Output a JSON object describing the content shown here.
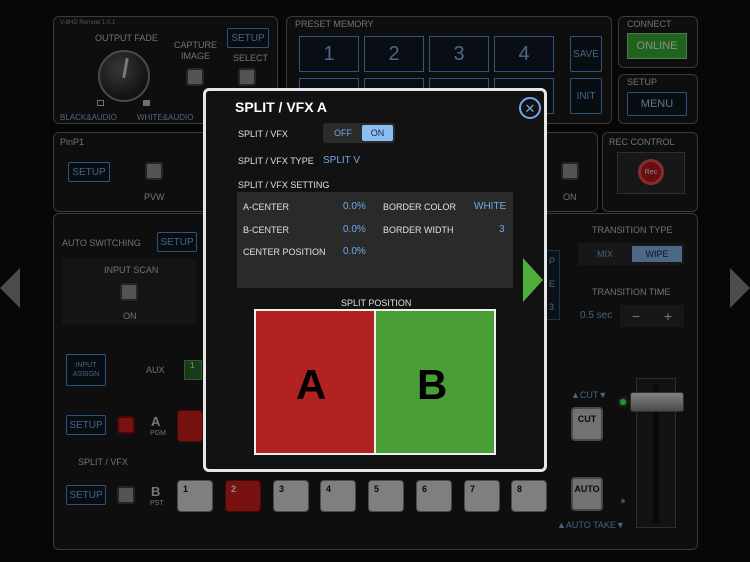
{
  "header": {
    "brand": "V-8HD Remote 1.0.1",
    "output_fade": "OUTPUT FADE",
    "black_audio": "BLACK&AUDIO",
    "white_audio": "WHITE&AUDIO",
    "capture_image": "CAPTURE\nIMAGE",
    "setup": "SETUP",
    "select": "SELECT"
  },
  "preset": {
    "title": "PRESET MEMORY",
    "buttons": [
      "1",
      "2",
      "3",
      "4"
    ],
    "save": "SAVE",
    "init": "INIT"
  },
  "connect": {
    "title": "CONNECT",
    "button": "ONLINE"
  },
  "setup_panel": {
    "title": "SETUP",
    "button": "MENU"
  },
  "pinp": {
    "title": "PinP1",
    "setup": "SETUP",
    "pvw": "PVW",
    "on": "ON"
  },
  "rec": {
    "title": "REC CONTROL",
    "button": "Rec"
  },
  "auto_switching": {
    "title": "AUTO SWITCHING",
    "setup": "SETUP",
    "input_scan": "INPUT SCAN",
    "on": "ON"
  },
  "transition": {
    "type_title": "TRANSITION TYPE",
    "mix": "MIX",
    "wipe": "WIPE",
    "time_title": "TRANSITION TIME",
    "time_value": "0.5 sec",
    "minus": "−",
    "plus": "+"
  },
  "bottom": {
    "input_assign": "INPUT\nASSIGN",
    "aux": "AUX",
    "aux_value": "1",
    "setup1": "SETUP",
    "setup2": "SETUP",
    "a_letter": "A",
    "pgm": "PGM",
    "b_letter": "B",
    "pst": "PST",
    "split_vfx": "SPLIT / VFX",
    "cut_top": "▲CUT▼",
    "cut": "CUT",
    "auto": "AUTO",
    "auto_take": "▲AUTO TAKE▼",
    "pst_keys": [
      "1",
      "2",
      "3",
      "4",
      "5",
      "6",
      "7",
      "8"
    ],
    "partial_a": "P",
    "partial_b": "E",
    "partial_c": "3"
  },
  "modal": {
    "title": "SPLIT / VFX A",
    "split_vfx_label": "SPLIT / VFX",
    "off": "OFF",
    "on": "ON",
    "type_label": "SPLIT / VFX TYPE",
    "type_value": "SPLIT V",
    "setting_label": "SPLIT / VFX SETTING",
    "a_center_label": "A-CENTER",
    "a_center_value": "0.0%",
    "b_center_label": "B-CENTER",
    "b_center_value": "0.0%",
    "center_pos_label": "CENTER POSITION",
    "center_pos_value": "0.0%",
    "border_color_label": "BORDER COLOR",
    "border_color_value": "WHITE",
    "border_width_label": "BORDER WIDTH",
    "border_width_value": "3",
    "split_position": "SPLIT POSITION",
    "a": "A",
    "b": "B"
  },
  "colors": {
    "accent_blue": "#5a9ae0",
    "online_green": "#3ab53a",
    "red": "#b22222",
    "green": "#4a9e38"
  }
}
